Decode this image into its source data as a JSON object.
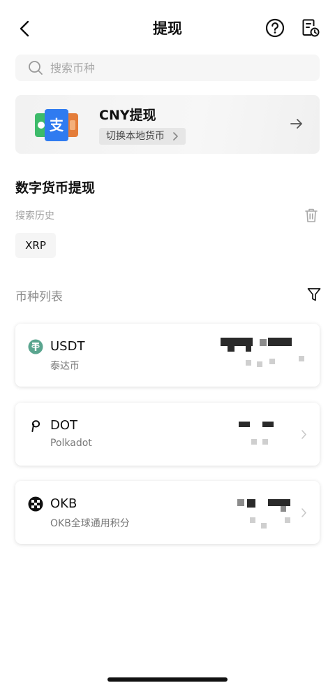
{
  "header": {
    "title": "提现"
  },
  "search": {
    "placeholder": "搜索币种"
  },
  "cny_card": {
    "title": "CNY提现",
    "switch_label": "切换本地货币"
  },
  "section": {
    "title": "数字货币提现"
  },
  "history": {
    "label": "搜索历史",
    "chips": [
      "XRP"
    ]
  },
  "coin_list": {
    "label": "币种列表",
    "items": [
      {
        "symbol": "USDT",
        "name": "泰达币",
        "icon": "tether-icon"
      },
      {
        "symbol": "DOT",
        "name": "Polkadot",
        "icon": "polkadot-icon"
      },
      {
        "symbol": "OKB",
        "name": "OKB全球通用积分",
        "icon": "okb-icon"
      }
    ]
  },
  "colors": {
    "tether": "#5aa58f",
    "accent": "#111111"
  }
}
